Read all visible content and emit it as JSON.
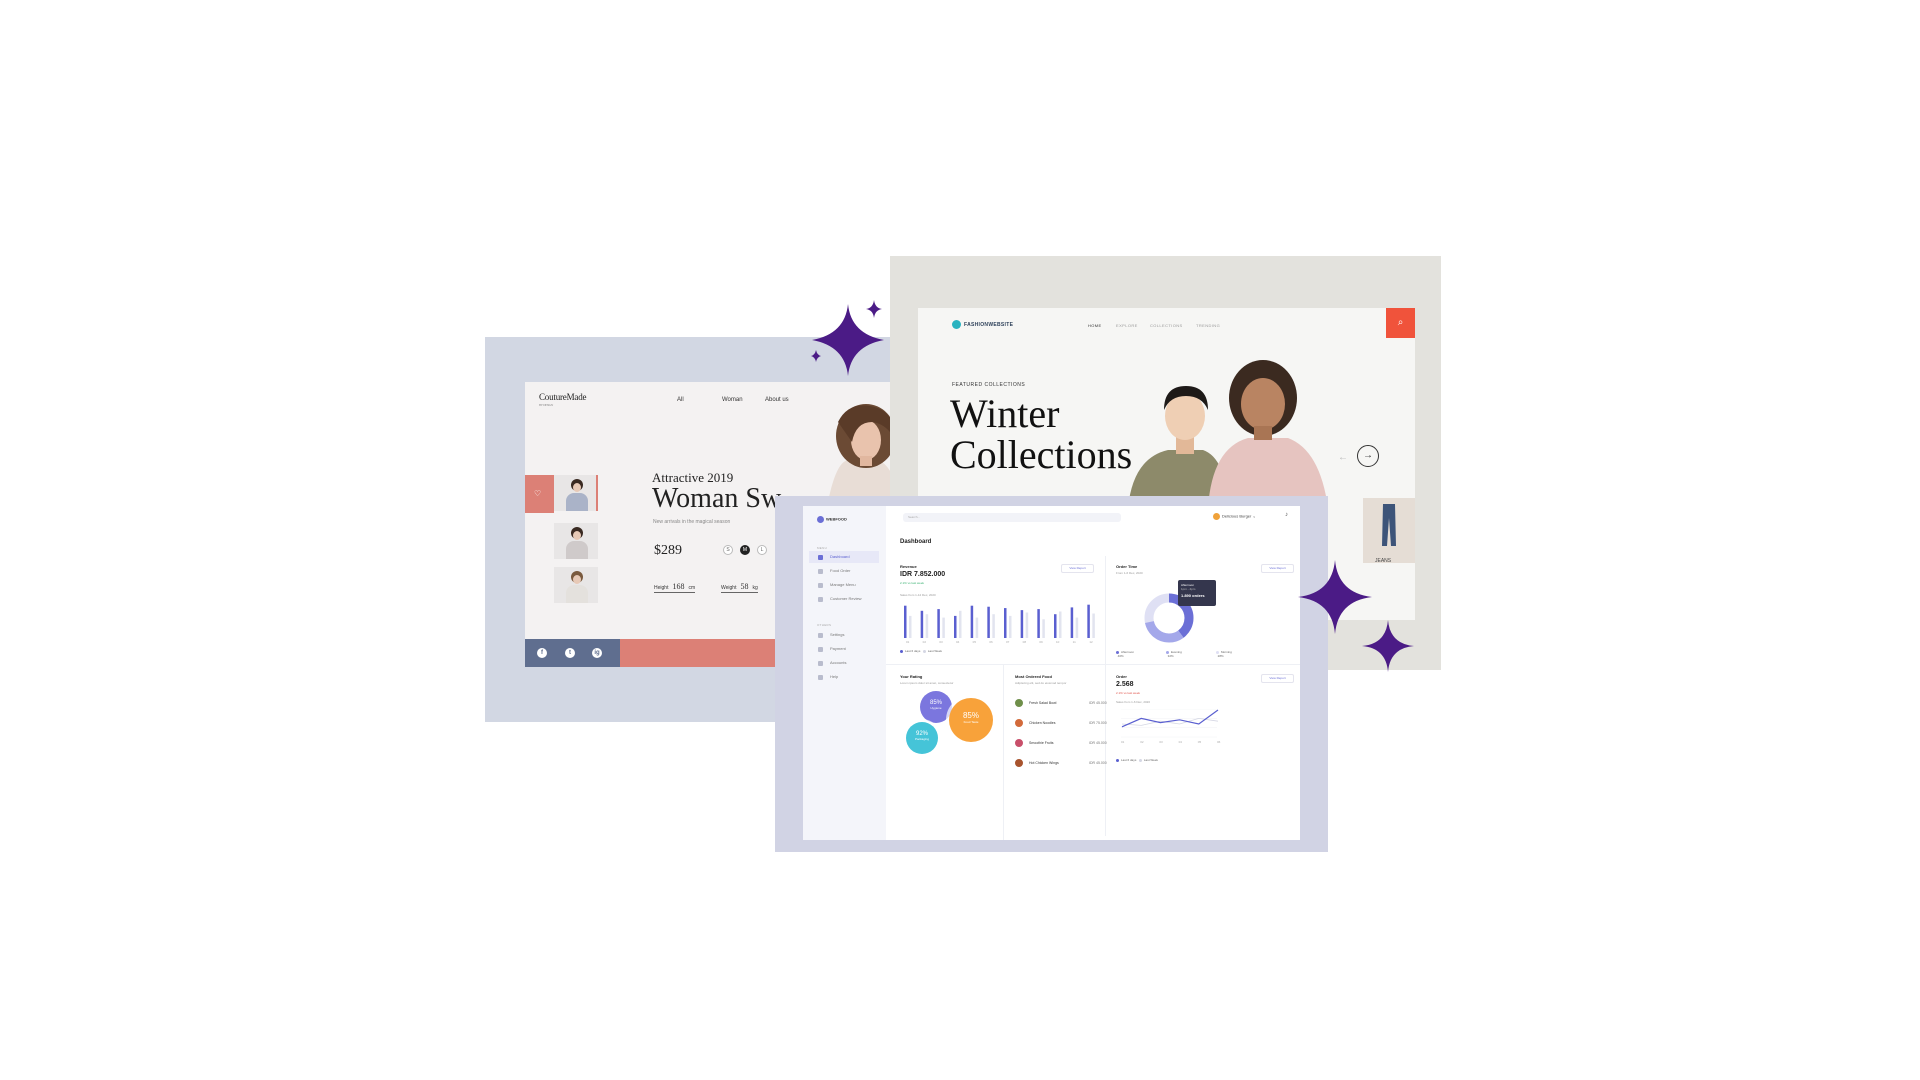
{
  "couture": {
    "logo": "CoutureMade",
    "logo_sub": "BY DESIGN",
    "nav": [
      "All",
      "Woman",
      "About us"
    ],
    "subheading": "Attractive 2019",
    "heading": "Woman Sw",
    "description": "New arrivals in the magical season",
    "price": "$289",
    "sizes": [
      "S",
      "M",
      "L"
    ],
    "height_label": "Height",
    "height_value": "168",
    "height_unit": "cm",
    "weight_label": "Weight",
    "weight_value": "58",
    "weight_unit": "kg",
    "social": [
      "f",
      "t",
      "ig"
    ],
    "colors": {
      "accent": "#dc8076",
      "nav": "#5f6e8f"
    }
  },
  "fashion": {
    "brand": "FASHIONWEBSITE",
    "nav": [
      "HOME",
      "EXPLORE",
      "COLLECTIONS",
      "TRENDING"
    ],
    "featured": "FEATURED COLLECTIONS",
    "title_line1": "Winter",
    "title_line2": "Collections",
    "arrow_prev": "←",
    "arrow_next": "→",
    "product_label": "JEANS",
    "colors": {
      "search": "#f0533b",
      "brand": "#2ab3c0"
    }
  },
  "dashboard": {
    "brand": "WEBFOOD",
    "search_placeholder": "Search...",
    "user": "Delicious Burger",
    "menu_group": "MENU",
    "others_group": "OTHERS",
    "menu": [
      "Dashboard",
      "Food Order",
      "Manage Menu",
      "Customer Review"
    ],
    "others": [
      "Settings",
      "Payment",
      "Accounts",
      "Help"
    ],
    "page_title": "Dashboard",
    "revenue": {
      "title": "Revenue",
      "value": "IDR 7.852.000",
      "change": "2.1% vs last week",
      "range": "Sales from 1-12 Dec, 2020",
      "button": "View Report",
      "legend": [
        "Last 6 days",
        "Last Week"
      ]
    },
    "order_time": {
      "title": "Order Time",
      "range": "From 1-6 Dec, 2020",
      "button": "View Report",
      "tooltip_title": "Afternoon",
      "tooltip_time": "1pm - 4pm",
      "tooltip_value": "1.890 orders",
      "legend": [
        {
          "name": "Afternoon",
          "pct": "40%"
        },
        {
          "name": "Evening",
          "pct": "32%"
        },
        {
          "name": "Morning",
          "pct": "28%"
        }
      ]
    },
    "rating": {
      "title": "Your Rating",
      "sub": "Lorem ipsum dolor sit amet, consectetur",
      "bubbles": [
        {
          "value": "85%",
          "label": "Hygiene"
        },
        {
          "value": "85%",
          "label": "Food Taste"
        },
        {
          "value": "92%",
          "label": "Packaging"
        }
      ]
    },
    "most_ordered": {
      "title": "Most Ordered Food",
      "sub": "Adipiscing elit, sed do eiusmod tempor",
      "items": [
        {
          "name": "Fresh Salad Bowl",
          "price": "IDR 45.000"
        },
        {
          "name": "Chicken Noodles",
          "price": "IDR 75.000"
        },
        {
          "name": "Smoothie Fruits",
          "price": "IDR 45.000"
        },
        {
          "name": "Hot Chicken Wings",
          "price": "IDR 45.000"
        }
      ]
    },
    "order": {
      "title": "Order",
      "value": "2.568",
      "change": "2.1% vs last week",
      "range": "Sales from 1-6 Dec, 2020",
      "button": "View Report",
      "legend": [
        "Last 6 days",
        "Last Week"
      ]
    },
    "revenue_chart": {
      "type": "bar",
      "categories": [
        "01",
        "02",
        "03",
        "04",
        "05",
        "06",
        "07",
        "08",
        "09",
        "10",
        "11",
        "12"
      ],
      "series": [
        {
          "values": [
            0.95,
            0.8,
            0.85,
            0.65,
            0.95,
            0.92,
            0.88,
            0.82,
            0.85,
            0.7,
            0.9,
            0.98
          ]
        },
        {
          "values": [
            0.65,
            0.7,
            0.6,
            0.8,
            0.6,
            0.7,
            0.65,
            0.75,
            0.55,
            0.78,
            0.6,
            0.72
          ]
        }
      ],
      "colors": [
        "#5a5fd0",
        "#e2e4ef"
      ]
    },
    "order_chart": {
      "type": "line",
      "categories": [
        "01",
        "02",
        "03",
        "04",
        "05",
        "06"
      ],
      "series": [
        {
          "values": [
            0.4,
            0.7,
            0.55,
            0.65,
            0.5,
            1.0
          ]
        },
        {
          "values": [
            0.5,
            0.45,
            0.6,
            0.5,
            0.7,
            0.6
          ]
        }
      ],
      "colors": [
        "#5a5fd0",
        "#d5d7e4"
      ]
    },
    "colors": {
      "primary": "#6b6fd6",
      "orange": "#f8a23a",
      "cyan": "#45c4d8",
      "purple": "#7b76de"
    }
  }
}
